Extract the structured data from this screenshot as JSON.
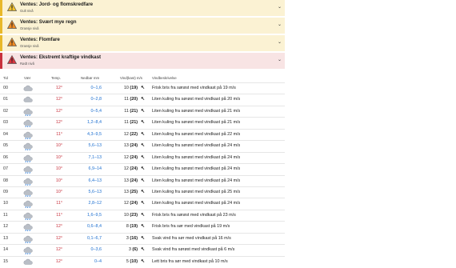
{
  "warnings": [
    {
      "title": "Ventes: Jord- og flomskredfare",
      "level": "Gult nivå",
      "severity": "yellow"
    },
    {
      "title": "Ventes: Svært mye regn",
      "level": "Oransje nivå",
      "severity": "yellow"
    },
    {
      "title": "Ventes: Flomfare",
      "level": "Oransje nivå",
      "severity": "yellow"
    },
    {
      "title": "Ventes: Ekstremt kraftige vindkast",
      "level": "Rødt nivå",
      "severity": "red"
    }
  ],
  "table": {
    "headers": {
      "time": "Tid",
      "weather": "Vær",
      "temp": "Temp.",
      "precip": "Nedbør mm",
      "wind": "Vind(kast) m/s",
      "desc": "Vindbeskrivelse"
    },
    "rows": [
      {
        "time": "00",
        "icon": "cloud-icon",
        "temp": "12°",
        "precip": "0–1,6",
        "wind": "10",
        "gust": "(19)",
        "desc": "Frisk bris fra sørøst med vindkast på 19 m/s"
      },
      {
        "time": "01",
        "icon": "cloud-icon",
        "temp": "12°",
        "precip": "0–2,8",
        "wind": "11",
        "gust": "(20)",
        "desc": "Liten kuling fra sørøst med vindkast på 20 m/s"
      },
      {
        "time": "02",
        "icon": "cloud-rain-icon",
        "temp": "12°",
        "precip": "0–5,4",
        "wind": "11",
        "gust": "(21)",
        "desc": "Liten kuling fra sørøst med vindkast på 21 m/s"
      },
      {
        "time": "03",
        "icon": "cloud-rain-icon",
        "temp": "12°",
        "precip": "1,2–8,4",
        "wind": "11",
        "gust": "(21)",
        "desc": "Liten kuling fra sørøst med vindkast på 21 m/s"
      },
      {
        "time": "04",
        "icon": "cloud-rain-icon",
        "temp": "11°",
        "precip": "4,3–9,5",
        "wind": "12",
        "gust": "(22)",
        "desc": "Liten kuling fra sørøst med vindkast på 22 m/s"
      },
      {
        "time": "05",
        "icon": "cloud-rain-icon",
        "temp": "10°",
        "precip": "5,6–13",
        "wind": "13",
        "gust": "(24)",
        "desc": "Liten kuling fra sørøst med vindkast på 24 m/s"
      },
      {
        "time": "06",
        "icon": "cloud-rain-icon",
        "temp": "10°",
        "precip": "7,1–13",
        "wind": "12",
        "gust": "(24)",
        "desc": "Liten kuling fra sørøst med vindkast på 24 m/s"
      },
      {
        "time": "07",
        "icon": "cloud-rain-icon",
        "temp": "10°",
        "precip": "6,9–14",
        "wind": "12",
        "gust": "(24)",
        "desc": "Liten kuling fra sørøst med vindkast på 24 m/s"
      },
      {
        "time": "08",
        "icon": "cloud-rain-icon",
        "temp": "10°",
        "precip": "6,4–13",
        "wind": "13",
        "gust": "(24)",
        "desc": "Liten kuling fra sørøst med vindkast på 24 m/s"
      },
      {
        "time": "09",
        "icon": "cloud-rain-icon",
        "temp": "10°",
        "precip": "5,6–13",
        "wind": "13",
        "gust": "(25)",
        "desc": "Liten kuling fra sørøst med vindkast på 25 m/s"
      },
      {
        "time": "10",
        "icon": "cloud-rain-icon",
        "temp": "11°",
        "precip": "2,8–12",
        "wind": "12",
        "gust": "(24)",
        "desc": "Liten kuling fra sørøst med vindkast på 24 m/s"
      },
      {
        "time": "11",
        "icon": "cloud-rain-icon",
        "temp": "11°",
        "precip": "1,6–9,5",
        "wind": "10",
        "gust": "(23)",
        "desc": "Frisk bris fra sørøst med vindkast på 23 m/s"
      },
      {
        "time": "12",
        "icon": "cloud-rain-icon",
        "temp": "12°",
        "precip": "0,6–8,4",
        "wind": "8",
        "gust": "(19)",
        "desc": "Frisk bris fra sør med vindkast på 19 m/s"
      },
      {
        "time": "13",
        "icon": "cloud-rain-icon",
        "temp": "12°",
        "precip": "0,1–6,7",
        "wind": "3",
        "gust": "(16)",
        "desc": "Svak vind fra sør med vindkast på 16 m/s"
      },
      {
        "time": "14",
        "icon": "cloud-rain-icon",
        "temp": "12°",
        "precip": "0–3,6",
        "wind": "3",
        "gust": "(6)",
        "desc": "Svak vind fra sørøst med vindkast på 6 m/s"
      },
      {
        "time": "15",
        "icon": "cloud-icon",
        "temp": "12°",
        "precip": "0–4",
        "wind": "5",
        "gust": "(10)",
        "desc": "Lett bris fra sør med vindkast på 10 m/s"
      }
    ]
  },
  "colors": {
    "temp_warm": "#c8303c",
    "precip": "#1d6fd0",
    "warn_yellow": "#e8b82a",
    "warn_red": "#c8303c"
  }
}
